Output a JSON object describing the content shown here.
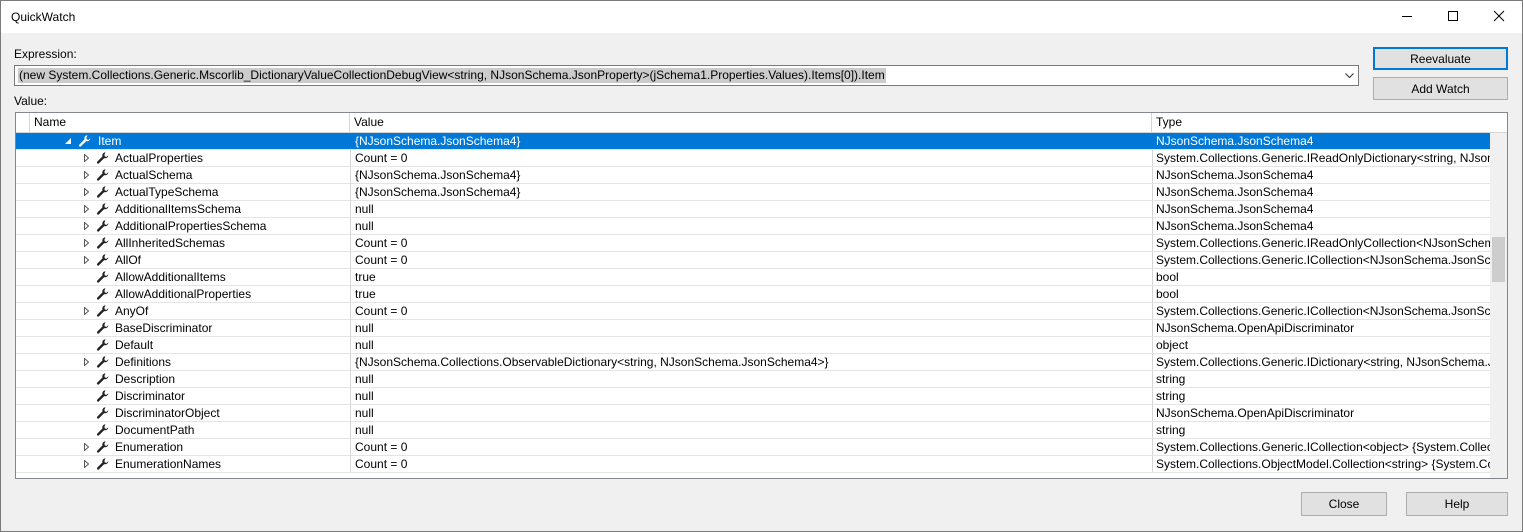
{
  "window": {
    "title": "QuickWatch",
    "minimize_icon": "minimize-icon",
    "maximize_icon": "maximize-icon",
    "close_icon": "close-icon"
  },
  "expression": {
    "label": "Expression:",
    "value": "(new System.Collections.Generic.Mscorlib_DictionaryValueCollectionDebugView<string, NJsonSchema.JsonProperty>(jSchema1.Properties.Values).Items[0]).Item"
  },
  "buttons": {
    "reevaluate": "Reevaluate",
    "add_watch": "Add Watch",
    "close": "Close",
    "help": "Help"
  },
  "value_label": "Value:",
  "grid": {
    "columns": [
      "Name",
      "Value",
      "Type"
    ],
    "rows": [
      {
        "name": "Item",
        "value": "{NJsonSchema.JsonSchema4}",
        "type": "NJsonSchema.JsonSchema4",
        "expander": "expanded",
        "selected": true
      },
      {
        "name": "ActualProperties",
        "value": "Count = 0",
        "type": "System.Collections.Generic.IReadOnlyDictionary<string, NJsonS",
        "expander": "collapsed"
      },
      {
        "name": "ActualSchema",
        "value": "{NJsonSchema.JsonSchema4}",
        "type": "NJsonSchema.JsonSchema4",
        "expander": "collapsed"
      },
      {
        "name": "ActualTypeSchema",
        "value": "{NJsonSchema.JsonSchema4}",
        "type": "NJsonSchema.JsonSchema4",
        "expander": "collapsed"
      },
      {
        "name": "AdditionalItemsSchema",
        "value": "null",
        "type": "NJsonSchema.JsonSchema4",
        "expander": "collapsed"
      },
      {
        "name": "AdditionalPropertiesSchema",
        "value": "null",
        "type": "NJsonSchema.JsonSchema4",
        "expander": "collapsed"
      },
      {
        "name": "AllInheritedSchemas",
        "value": "Count = 0",
        "type": "System.Collections.Generic.IReadOnlyCollection<NJsonSchema",
        "expander": "collapsed"
      },
      {
        "name": "AllOf",
        "value": "Count = 0",
        "type": "System.Collections.Generic.ICollection<NJsonSchema.JsonSche",
        "expander": "collapsed"
      },
      {
        "name": "AllowAdditionalItems",
        "value": "true",
        "type": "bool",
        "expander": "none"
      },
      {
        "name": "AllowAdditionalProperties",
        "value": "true",
        "type": "bool",
        "expander": "none"
      },
      {
        "name": "AnyOf",
        "value": "Count = 0",
        "type": "System.Collections.Generic.ICollection<NJsonSchema.JsonSche",
        "expander": "collapsed"
      },
      {
        "name": "BaseDiscriminator",
        "value": "null",
        "type": "NJsonSchema.OpenApiDiscriminator",
        "expander": "none"
      },
      {
        "name": "Default",
        "value": "null",
        "type": "object",
        "expander": "none"
      },
      {
        "name": "Definitions",
        "value": "{NJsonSchema.Collections.ObservableDictionary<string, NJsonSchema.JsonSchema4>}",
        "type": "System.Collections.Generic.IDictionary<string, NJsonSchema.Js",
        "expander": "collapsed"
      },
      {
        "name": "Description",
        "value": "null",
        "type": "string",
        "expander": "none"
      },
      {
        "name": "Discriminator",
        "value": "null",
        "type": "string",
        "expander": "none"
      },
      {
        "name": "DiscriminatorObject",
        "value": "null",
        "type": "NJsonSchema.OpenApiDiscriminator",
        "expander": "none"
      },
      {
        "name": "DocumentPath",
        "value": "null",
        "type": "string",
        "expander": "none"
      },
      {
        "name": "Enumeration",
        "value": "Count = 0",
        "type": "System.Collections.Generic.ICollection<object> {System.Collec",
        "expander": "collapsed"
      },
      {
        "name": "EnumerationNames",
        "value": "Count = 0",
        "type": "System.Collections.ObjectModel.Collection<string> {System.Co",
        "expander": "collapsed"
      }
    ]
  },
  "colors": {
    "selection": "#0078d7",
    "default_button_border": "#0078d7"
  }
}
